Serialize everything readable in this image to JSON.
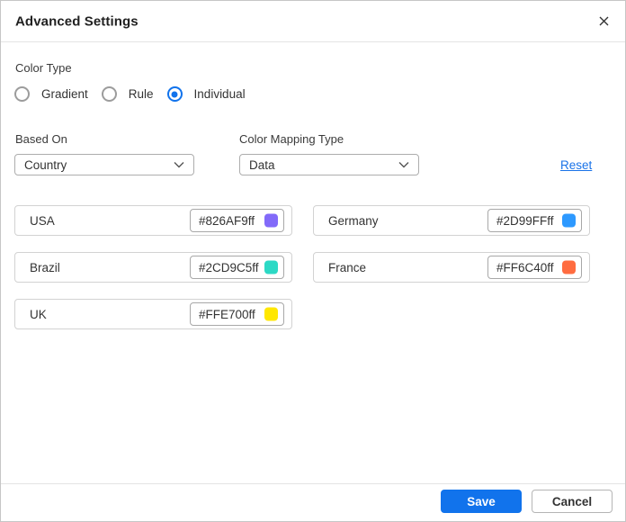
{
  "dialog": {
    "title": "Advanced Settings"
  },
  "color_type": {
    "label": "Color Type",
    "options": [
      {
        "label": "Gradient",
        "selected": false
      },
      {
        "label": "Rule",
        "selected": false
      },
      {
        "label": "Individual",
        "selected": true
      }
    ]
  },
  "based_on": {
    "label": "Based On",
    "value": "Country"
  },
  "color_mapping_type": {
    "label": "Color Mapping Type",
    "value": "Data"
  },
  "reset_label": "Reset",
  "color_mappings": [
    {
      "name": "USA",
      "hex": "#826AF9ff",
      "swatch": "#826AF9"
    },
    {
      "name": "Germany",
      "hex": "#2D99FFff",
      "swatch": "#2D99FF"
    },
    {
      "name": "Brazil",
      "hex": "#2CD9C5ff",
      "swatch": "#2CD9C5"
    },
    {
      "name": "France",
      "hex": "#FF6C40ff",
      "swatch": "#FF6C40"
    },
    {
      "name": "UK",
      "hex": "#FFE700ff",
      "swatch": "#FFE700"
    }
  ],
  "footer": {
    "save_label": "Save",
    "cancel_label": "Cancel"
  },
  "colors": {
    "accent_blue": "#1173EC",
    "link_blue": "#1A73E8"
  }
}
